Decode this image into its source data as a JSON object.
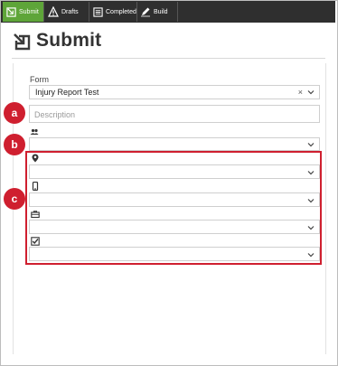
{
  "tabs": [
    {
      "label": "Submit",
      "icon": "submit-icon",
      "active": true
    },
    {
      "label": "Drafts",
      "icon": "warning-icon",
      "active": false
    },
    {
      "label": "Completed",
      "icon": "completed-icon",
      "active": false
    },
    {
      "label": "Build",
      "icon": "pencil-icon",
      "active": false
    }
  ],
  "page": {
    "title": "Submit"
  },
  "form": {
    "label": "Form",
    "selected": "Injury Report Test",
    "description_placeholder": "Description"
  },
  "markers": {
    "a": "a",
    "b": "b",
    "c": "c"
  },
  "colors": {
    "accent_green": "#5ea539",
    "tabbar": "#2f2f2f",
    "highlight_red": "#cf1f2f"
  },
  "fields": [
    {
      "icon": "people-icon"
    },
    {
      "icon": "location-pin-icon"
    },
    {
      "icon": "mobile-device-icon"
    },
    {
      "icon": "briefcase-icon"
    },
    {
      "icon": "checkbox-icon"
    }
  ]
}
